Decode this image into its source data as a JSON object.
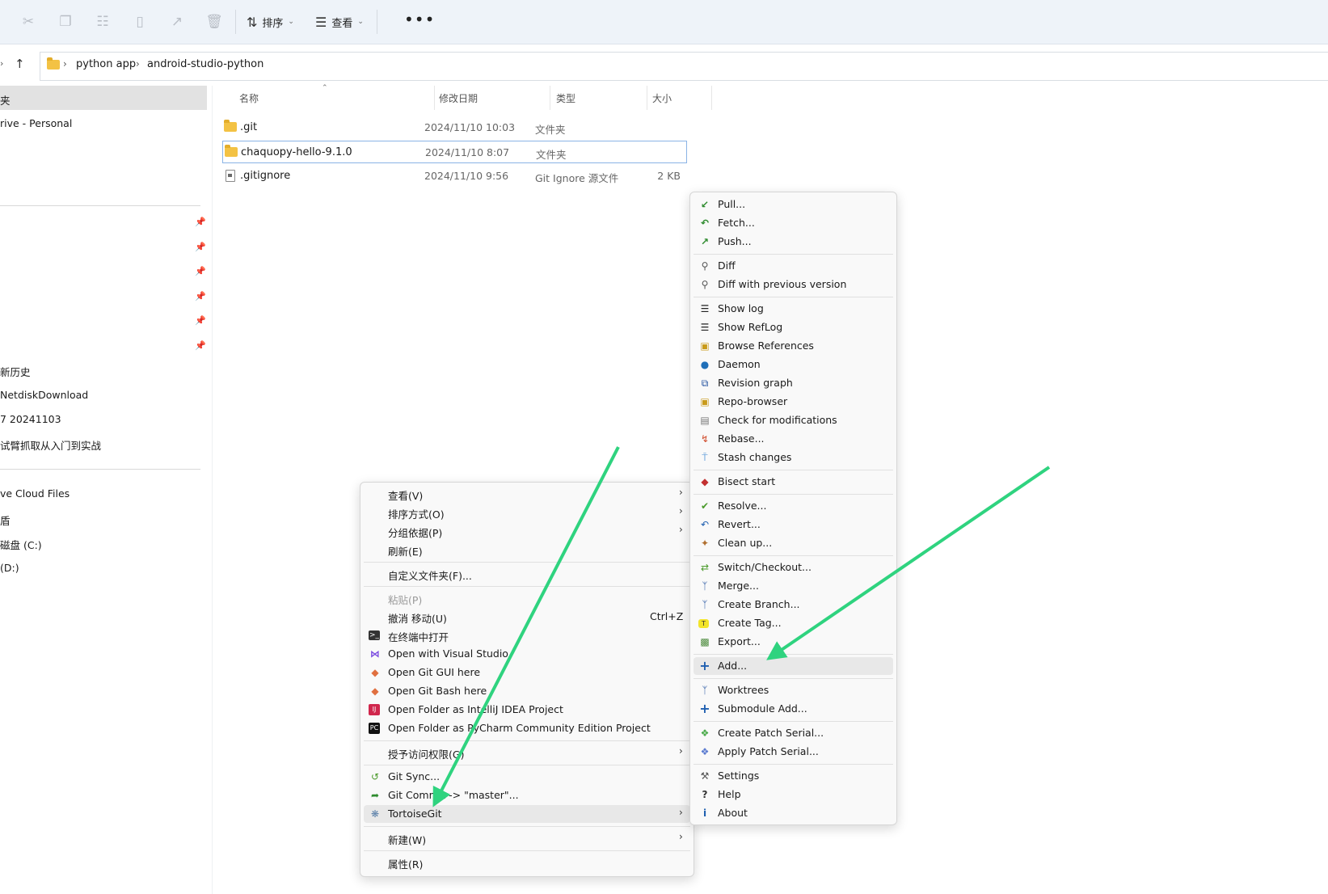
{
  "toolbar": {
    "icons": [
      "cut-icon",
      "copy-icon",
      "paste-icon",
      "rename-icon",
      "share-icon",
      "delete-icon"
    ],
    "sort_label": "排序",
    "view_label": "查看",
    "more_label": "•••"
  },
  "address": {
    "crumbs": [
      "python app",
      "android-studio-python"
    ]
  },
  "nav": {
    "items": [
      {
        "label": "夹"
      },
      {
        "label": "rive - Personal"
      },
      {
        "label": "新历史"
      },
      {
        "label": "NetdiskDownload"
      },
      {
        "label": "7 20241103"
      },
      {
        "label": "试臂抓取从入门到实战"
      },
      {
        "label": "ve Cloud Files"
      },
      {
        "label": "盾"
      },
      {
        "label": "磁盘 (C:)"
      },
      {
        "label": " (D:)"
      }
    ]
  },
  "columns": {
    "name": "名称",
    "date": "修改日期",
    "type": "类型",
    "size": "大小"
  },
  "files": [
    {
      "name": ".git",
      "date": "2024/11/10 10:03",
      "type": "文件夹",
      "size": ""
    },
    {
      "name": "chaquopy-hello-9.1.0",
      "date": "2024/11/10 8:07",
      "type": "文件夹",
      "size": ""
    },
    {
      "name": ".gitignore",
      "date": "2024/11/10 9:56",
      "type": "Git Ignore 源文件",
      "size": "2 KB"
    }
  ],
  "context_menu": {
    "items": [
      {
        "label": "查看(V)",
        "arrow": true
      },
      {
        "label": "排序方式(O)",
        "arrow": true
      },
      {
        "label": "分组依据(P)",
        "arrow": true
      },
      {
        "label": "刷新(E)"
      },
      {
        "label": "自定义文件夹(F)..."
      },
      {
        "label": "粘贴(P)",
        "disabled": true
      },
      {
        "label": "撤消 移动(U)",
        "shortcut": "Ctrl+Z"
      },
      {
        "label": "在终端中打开",
        "icon": "terminal-icon"
      },
      {
        "label": "Open with Visual Studio",
        "icon": "visual-studio-icon"
      },
      {
        "label": "Open Git GUI here",
        "icon": "git-gui-icon"
      },
      {
        "label": "Open Git Bash here",
        "icon": "git-bash-icon"
      },
      {
        "label": "Open Folder as IntelliJ IDEA Project",
        "icon": "intellij-icon"
      },
      {
        "label": "Open Folder as PyCharm Community Edition Project",
        "icon": "pycharm-icon"
      },
      {
        "label": "授予访问权限(G)",
        "arrow": true
      },
      {
        "label": "Git Sync...",
        "icon": "git-sync-icon"
      },
      {
        "label": "Git Commit -> \"master\"...",
        "icon": "git-commit-icon"
      },
      {
        "label": "TortoiseGit",
        "icon": "tortoisegit-icon",
        "arrow": true
      },
      {
        "label": "新建(W)",
        "arrow": true
      },
      {
        "label": "属性(R)"
      }
    ]
  },
  "tortoise_menu": {
    "items": [
      {
        "label": "Pull...",
        "icon": "pull-icon"
      },
      {
        "label": "Fetch...",
        "icon": "fetch-icon"
      },
      {
        "label": "Push...",
        "icon": "push-icon"
      },
      {
        "label": "Diff",
        "icon": "diff-icon"
      },
      {
        "label": "Diff with previous version",
        "icon": "diff-previous-icon"
      },
      {
        "label": "Show log",
        "icon": "show-log-icon"
      },
      {
        "label": "Show RefLog",
        "icon": "show-reflog-icon"
      },
      {
        "label": "Browse References",
        "icon": "browse-references-icon"
      },
      {
        "label": "Daemon",
        "icon": "daemon-icon"
      },
      {
        "label": "Revision graph",
        "icon": "revision-graph-icon"
      },
      {
        "label": "Repo-browser",
        "icon": "repo-browser-icon"
      },
      {
        "label": "Check for modifications",
        "icon": "check-modifications-icon"
      },
      {
        "label": "Rebase...",
        "icon": "rebase-icon"
      },
      {
        "label": "Stash changes",
        "icon": "stash-icon"
      },
      {
        "label": "Bisect start",
        "icon": "bisect-icon"
      },
      {
        "label": "Resolve...",
        "icon": "resolve-icon"
      },
      {
        "label": "Revert...",
        "icon": "revert-icon"
      },
      {
        "label": "Clean up...",
        "icon": "cleanup-icon"
      },
      {
        "label": "Switch/Checkout...",
        "icon": "switch-icon"
      },
      {
        "label": "Merge...",
        "icon": "merge-icon"
      },
      {
        "label": "Create Branch...",
        "icon": "branch-icon"
      },
      {
        "label": "Create Tag...",
        "icon": "tag-icon"
      },
      {
        "label": "Export...",
        "icon": "export-icon"
      },
      {
        "label": "Add...",
        "icon": "add-icon"
      },
      {
        "label": "Worktrees",
        "icon": "worktrees-icon"
      },
      {
        "label": "Submodule Add...",
        "icon": "submodule-add-icon"
      },
      {
        "label": "Create Patch Serial...",
        "icon": "create-patch-icon"
      },
      {
        "label": "Apply Patch Serial...",
        "icon": "apply-patch-icon"
      },
      {
        "label": "Settings",
        "icon": "settings-icon"
      },
      {
        "label": "Help",
        "icon": "help-icon"
      },
      {
        "label": "About",
        "icon": "about-icon"
      }
    ]
  },
  "colors": {
    "annotation_arrow": "#2fd37f",
    "selection_border": "#8ab4e6"
  }
}
